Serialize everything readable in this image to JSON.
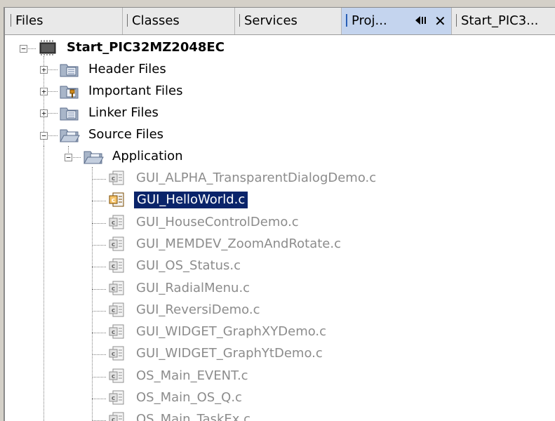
{
  "tabs": [
    {
      "label": "Files"
    },
    {
      "label": "Classes"
    },
    {
      "label": "Services"
    },
    {
      "label": "Proj..."
    },
    {
      "label": "Start_PIC3..."
    }
  ],
  "tab_controls": {
    "restore": "◀⏸",
    "close": "✕"
  },
  "tree": {
    "root": "Start_PIC32MZ2048EC",
    "folders": [
      "Header Files",
      "Important Files",
      "Linker Files",
      "Source Files"
    ],
    "application": "Application",
    "files": [
      "GUI_ALPHA_TransparentDialogDemo.c",
      "GUI_HelloWorld.c",
      "GUI_HouseControlDemo.c",
      "GUI_MEMDEV_ZoomAndRotate.c",
      "GUI_OS_Status.c",
      "GUI_RadialMenu.c",
      "GUI_ReversiDemo.c",
      "GUI_WIDGET_GraphXYDemo.c",
      "GUI_WIDGET_GraphYtDemo.c",
      "OS_Main_EVENT.c",
      "OS_Main_OS_Q.c",
      "OS_Main_TaskEx.c"
    ]
  }
}
